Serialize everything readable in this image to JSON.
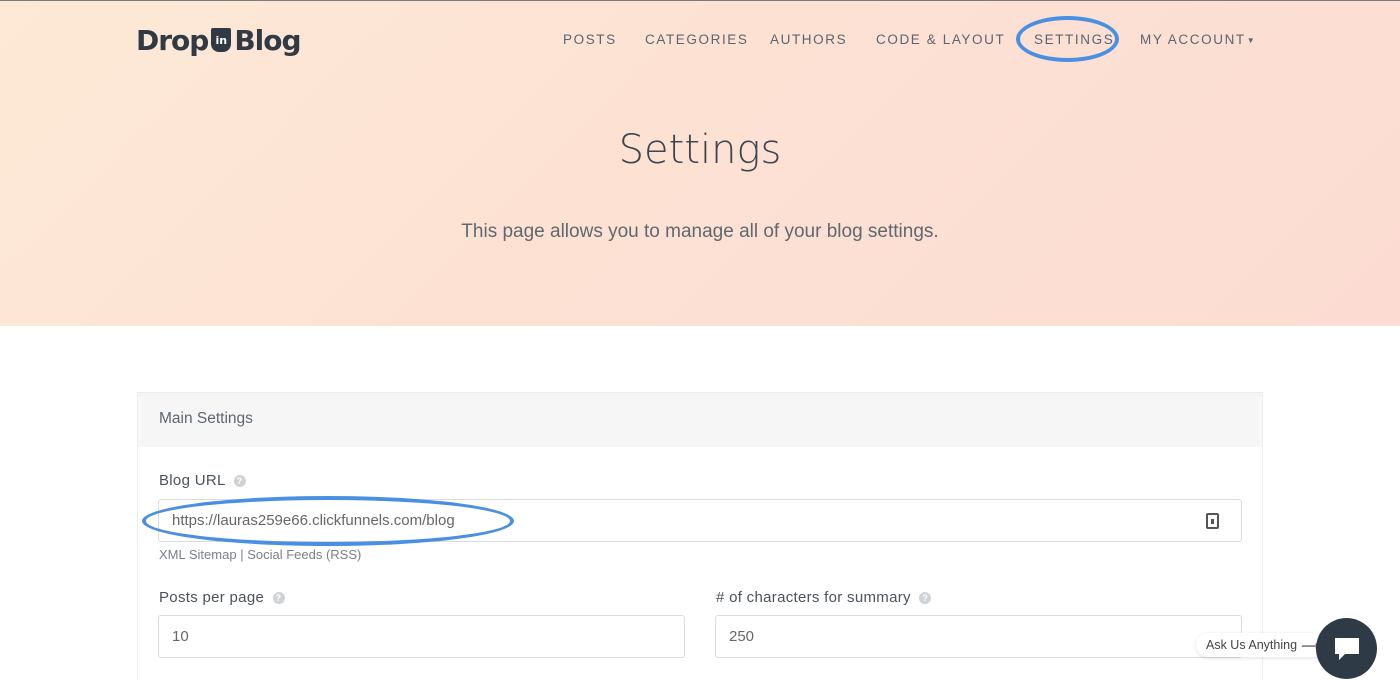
{
  "brand": {
    "part1": "Drop",
    "badge": "in",
    "part2": "Blog"
  },
  "nav": {
    "posts": "POSTS",
    "categories": "CATEGORIES",
    "authors": "AUTHORS",
    "code_layout": "CODE & LAYOUT",
    "settings": "SETTINGS",
    "account": "MY ACCOUNT"
  },
  "hero": {
    "title": "Settings",
    "subtitle": "This page allows you to manage all of your blog settings."
  },
  "main_settings": {
    "heading": "Main Settings",
    "blog_url_label": "Blog URL",
    "blog_url_value": "https://lauras259e66.clickfunnels.com/blog",
    "link_sitemap": "XML Sitemap",
    "link_separator": "|",
    "link_feeds": "Social Feeds (RSS)",
    "posts_per_page_label": "Posts per page",
    "posts_per_page_value": "10",
    "summary_chars_label": "# of characters for summary",
    "summary_chars_value": "250"
  },
  "chat": {
    "label": "Ask Us Anything"
  },
  "colors": {
    "highlight": "#4a90e2",
    "dark": "#2e3a45"
  }
}
